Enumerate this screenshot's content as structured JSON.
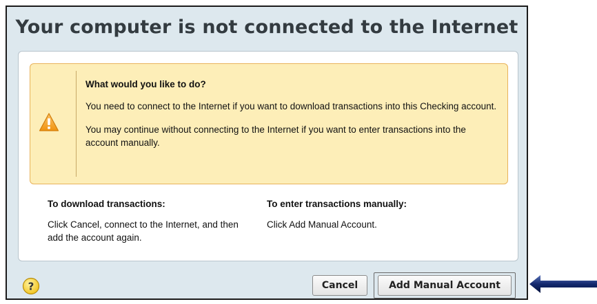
{
  "dialog": {
    "title": "Your computer is not connected to the Internet"
  },
  "warning": {
    "icon": "warning-triangle-icon",
    "heading": "What would you like to do?",
    "paragraph_1": "You need to connect to the Internet if you want to download transactions into this Checking account.",
    "paragraph_2": "You may continue without connecting to the Internet if you want to enter transactions into the account manually."
  },
  "options": {
    "download": {
      "heading": "To download transactions:",
      "text": "Click Cancel, connect to the Internet, and then add the account again."
    },
    "manual": {
      "heading": "To enter transactions manually:",
      "text": "Click Add Manual Account."
    }
  },
  "footer": {
    "help_icon": "question-mark-icon",
    "cancel_label": "Cancel",
    "add_manual_label": "Add Manual Account"
  },
  "colors": {
    "dialog_background": "#dde8ee",
    "warning_background": "#fdeeb8",
    "warning_border": "#e8b25a",
    "arrow": "#0a1f5c"
  }
}
